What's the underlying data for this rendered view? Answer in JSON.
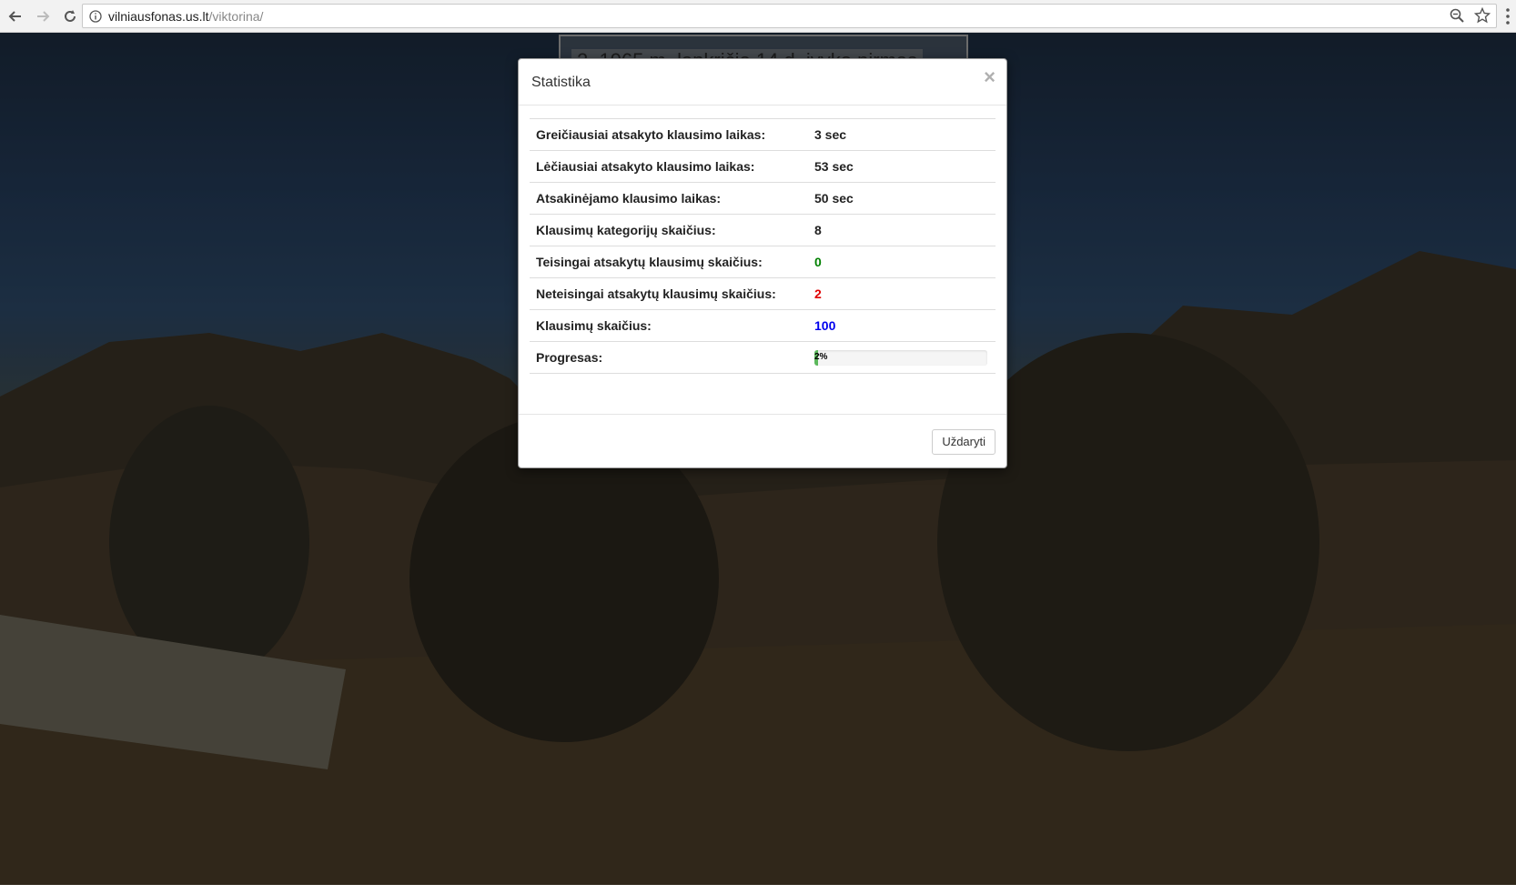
{
  "browser": {
    "url_host": "vilniausfonas.us.lt",
    "url_path": "/viktorina/"
  },
  "background": {
    "question_text": "2. 1965 m. lapkričio 14 d. įvyko pirmas"
  },
  "modal": {
    "title": "Statistika",
    "close_symbol": "×",
    "rows": [
      {
        "label": "Greičiausiai atsakyto klausimo laikas:",
        "value": "3 sec"
      },
      {
        "label": "Lėčiausiai atsakyto klausimo laikas:",
        "value": "53 sec"
      },
      {
        "label": "Atsakinėjamo klausimo laikas:",
        "value": "50 sec"
      },
      {
        "label": "Klausimų kategorijų skaičius:",
        "value": "8"
      },
      {
        "label": "Teisingai atsakytų klausimų skaičius:",
        "value": "0"
      },
      {
        "label": "Neteisingai atsakytų klausimų skaičius:",
        "value": "2"
      },
      {
        "label": "Klausimų skaičius:",
        "value": "100"
      }
    ],
    "progress_label": "Progresas:",
    "progress_text": "2%",
    "progress_fraction": 0.02,
    "close_button_label": "Uždaryti"
  },
  "colors": {
    "correct": "#008000",
    "incorrect": "#e00000",
    "total": "#0000ee",
    "progress": "#5cb85c"
  }
}
